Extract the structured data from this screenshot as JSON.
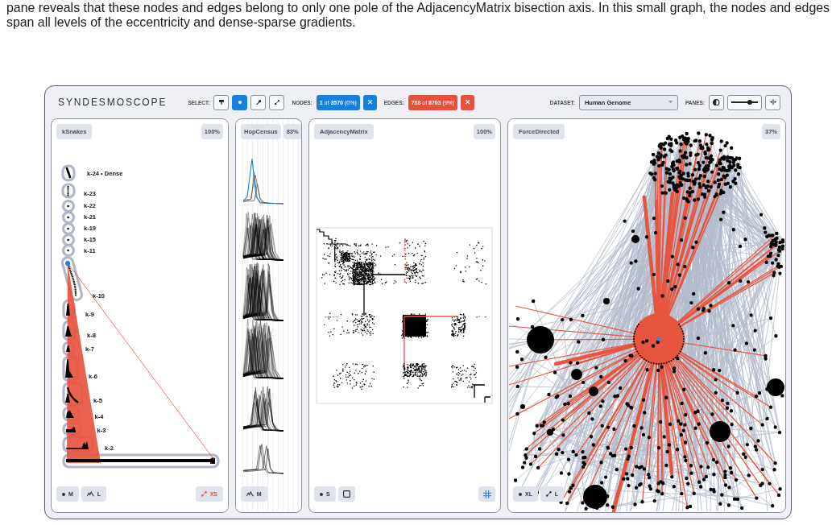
{
  "intro": {
    "text": "pane reveals that these nodes and edges belong to only one pole of the AdjacencyMatrix bisection axis. In this small graph, the nodes and edges span all levels of the eccentricity and dense-sparse gradients."
  },
  "app": {
    "title": "SYNDESMOSCOPE"
  },
  "toolbar": {
    "select": {
      "label": "SELECT:",
      "tools": [
        {
          "kind": "pin",
          "selected": false
        },
        {
          "kind": "node",
          "selected": true
        },
        {
          "kind": "needle",
          "selected": false
        },
        {
          "kind": "edge",
          "selected": false
        }
      ]
    },
    "nodes": {
      "label": "NODES:",
      "count": "**1** of **3570** (0%)"
    },
    "edges": {
      "label": "EDGES:",
      "count": "**788** of **8703** (9%)"
    },
    "dataset": {
      "label": "DATASET:",
      "value": "Human Genome"
    },
    "panes": {
      "label": "PANES:",
      "slider": {
        "level": 0.7
      }
    }
  },
  "panes": [
    {
      "kind": "ksnakes",
      "title": "kSnakes",
      "zoom": "100%",
      "levels": [
        "k-24 • Dense",
        "k-23",
        "k-22",
        "k-21",
        "k-19",
        "k-15",
        "k-11",
        "k-10",
        "k-9",
        "k-8",
        "k-7",
        "k-6",
        "k-5",
        "k-4",
        "k-3",
        "k-2"
      ],
      "controls": {
        "left": [
          {
            "kind": "nodes",
            "label": "M",
            "selected": false
          },
          {
            "kind": "hops",
            "label": "L",
            "selected": false
          }
        ],
        "right": [
          {
            "kind": "edges",
            "label": "XS",
            "selected": true
          }
        ]
      }
    },
    {
      "kind": "hops",
      "title": "HopCensus",
      "zoom": "83%",
      "controls": {
        "left": [
          {
            "kind": "hops",
            "label": "M",
            "selected": false
          }
        ]
      }
    },
    {
      "kind": "matrix",
      "title": "AdjacencyMatrix",
      "zoom": "100%",
      "controls": {
        "left": [
          {
            "kind": "nodes",
            "label": "S",
            "selected": false
          },
          {
            "kind": "square",
            "selected": false
          }
        ],
        "right": [
          {
            "kind": "grid",
            "selected": true
          }
        ]
      }
    },
    {
      "kind": "graph",
      "title": "ForceDirected",
      "zoom": "37%",
      "controls": {
        "left": [
          {
            "kind": "nodes",
            "label": "XL",
            "selected": false
          },
          {
            "kind": "edges",
            "label": "L",
            "selected": false
          }
        ]
      }
    }
  ]
}
